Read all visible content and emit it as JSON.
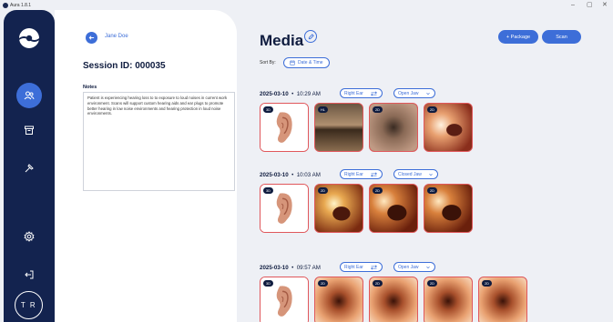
{
  "window": {
    "title": "Aura 1.8.1",
    "controls": [
      "–",
      "▢",
      "✕"
    ]
  },
  "sidebar": {
    "avatar_initials": "T R",
    "items": [
      {
        "icon": "patients-icon",
        "active": true
      },
      {
        "icon": "archive-icon",
        "active": false
      },
      {
        "icon": "tools-icon",
        "active": false
      },
      {
        "icon": "gear-icon",
        "active": false
      },
      {
        "icon": "logout-icon",
        "active": false
      }
    ]
  },
  "session": {
    "patient_name": "Jane Doe",
    "session_id": "Session ID: 000035",
    "notes_label": "Notes",
    "notes_text": "Patient is experiencing hearing loss to to exposure to loud noises in current work environment.  Scans will support custom hearing aids and ear plugs to promote better hearing in low noise environments and hearing protection in loud noise environments."
  },
  "media": {
    "title": "Media",
    "package_button": "+ Package",
    "scan_button": "Scan",
    "sort_label": "Sort By:",
    "sort_value": "Date & Time",
    "groups": [
      {
        "date": "2025-03-10",
        "time": "10:29 AM",
        "ear": "Right Ear",
        "jaw": "Open Jaw",
        "thumbs": [
          {
            "tag": "3D",
            "kind": "ear"
          },
          {
            "tag": "HL",
            "kind": "hl"
          },
          {
            "tag": "2D",
            "kind": "canal"
          },
          {
            "tag": "2D",
            "kind": "canal2"
          }
        ]
      },
      {
        "date": "2025-03-10",
        "time": "10:03 AM",
        "ear": "Right Ear",
        "jaw": "Closed Jaw",
        "thumbs": [
          {
            "tag": "3D",
            "kind": "ear"
          },
          {
            "tag": "2D",
            "kind": "canal3"
          },
          {
            "tag": "2D",
            "kind": "canal4"
          },
          {
            "tag": "2D",
            "kind": "canal4"
          }
        ]
      },
      {
        "date": "2025-03-10",
        "time": "09:57 AM",
        "ear": "Right Ear",
        "jaw": "Open Jaw",
        "thumbs": [
          {
            "tag": "3D",
            "kind": "ear"
          },
          {
            "tag": "2D",
            "kind": "canal5"
          },
          {
            "tag": "2D",
            "kind": "canal5"
          },
          {
            "tag": "2D",
            "kind": "canal5"
          },
          {
            "tag": "2D",
            "kind": "canal5"
          }
        ]
      }
    ]
  }
}
